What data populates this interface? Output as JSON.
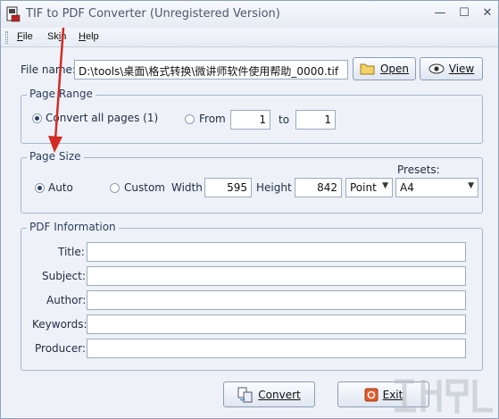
{
  "window": {
    "title": "TIF to PDF Converter (Unregistered Version)",
    "minimize": "—",
    "maximize": "☐",
    "close": "✕"
  },
  "menu": [
    {
      "label": "File",
      "accel": "F"
    },
    {
      "label": "Skin",
      "accel": "i"
    },
    {
      "label": "Help",
      "accel": "H"
    }
  ],
  "file": {
    "label": "File name:",
    "value": "D:\\tools\\桌面\\格式转换\\微讲师软件使用帮助_0000.tif",
    "open_label": "Open",
    "view_label": "View"
  },
  "page_range": {
    "title": "Page Range",
    "all_label": "Convert all pages (1)",
    "all_checked": true,
    "from_label": "From",
    "from_value": "1",
    "to_label": "to",
    "to_value": "1"
  },
  "page_size": {
    "title": "Page Size",
    "auto_label": "Auto",
    "auto_checked": true,
    "custom_label": "Custom",
    "width_label": "Width",
    "width_value": "595",
    "height_label": "Height",
    "height_value": "842",
    "unit_value": "Point",
    "presets_label": "Presets:",
    "presets_value": "A4"
  },
  "pdf_info": {
    "title": "PDF Information",
    "title_label": "Title:",
    "subject_label": "Subject:",
    "author_label": "Author:",
    "keywords_label": "Keywords:",
    "producer_label": "Producer:",
    "title_value": "",
    "subject_value": "",
    "author_value": "",
    "keywords_value": "",
    "producer_value": ""
  },
  "actions": {
    "convert_label": "Convert",
    "exit_label": "Exit"
  },
  "icons": {
    "app": "app-icon",
    "open": "folder-icon",
    "view": "eye-icon",
    "convert": "convert-icon",
    "exit": "exit-icon"
  },
  "colors": {
    "accent": "#2b3f66",
    "annotation_arrow": "#d42b24",
    "exit_icon": "#e25b2a"
  }
}
